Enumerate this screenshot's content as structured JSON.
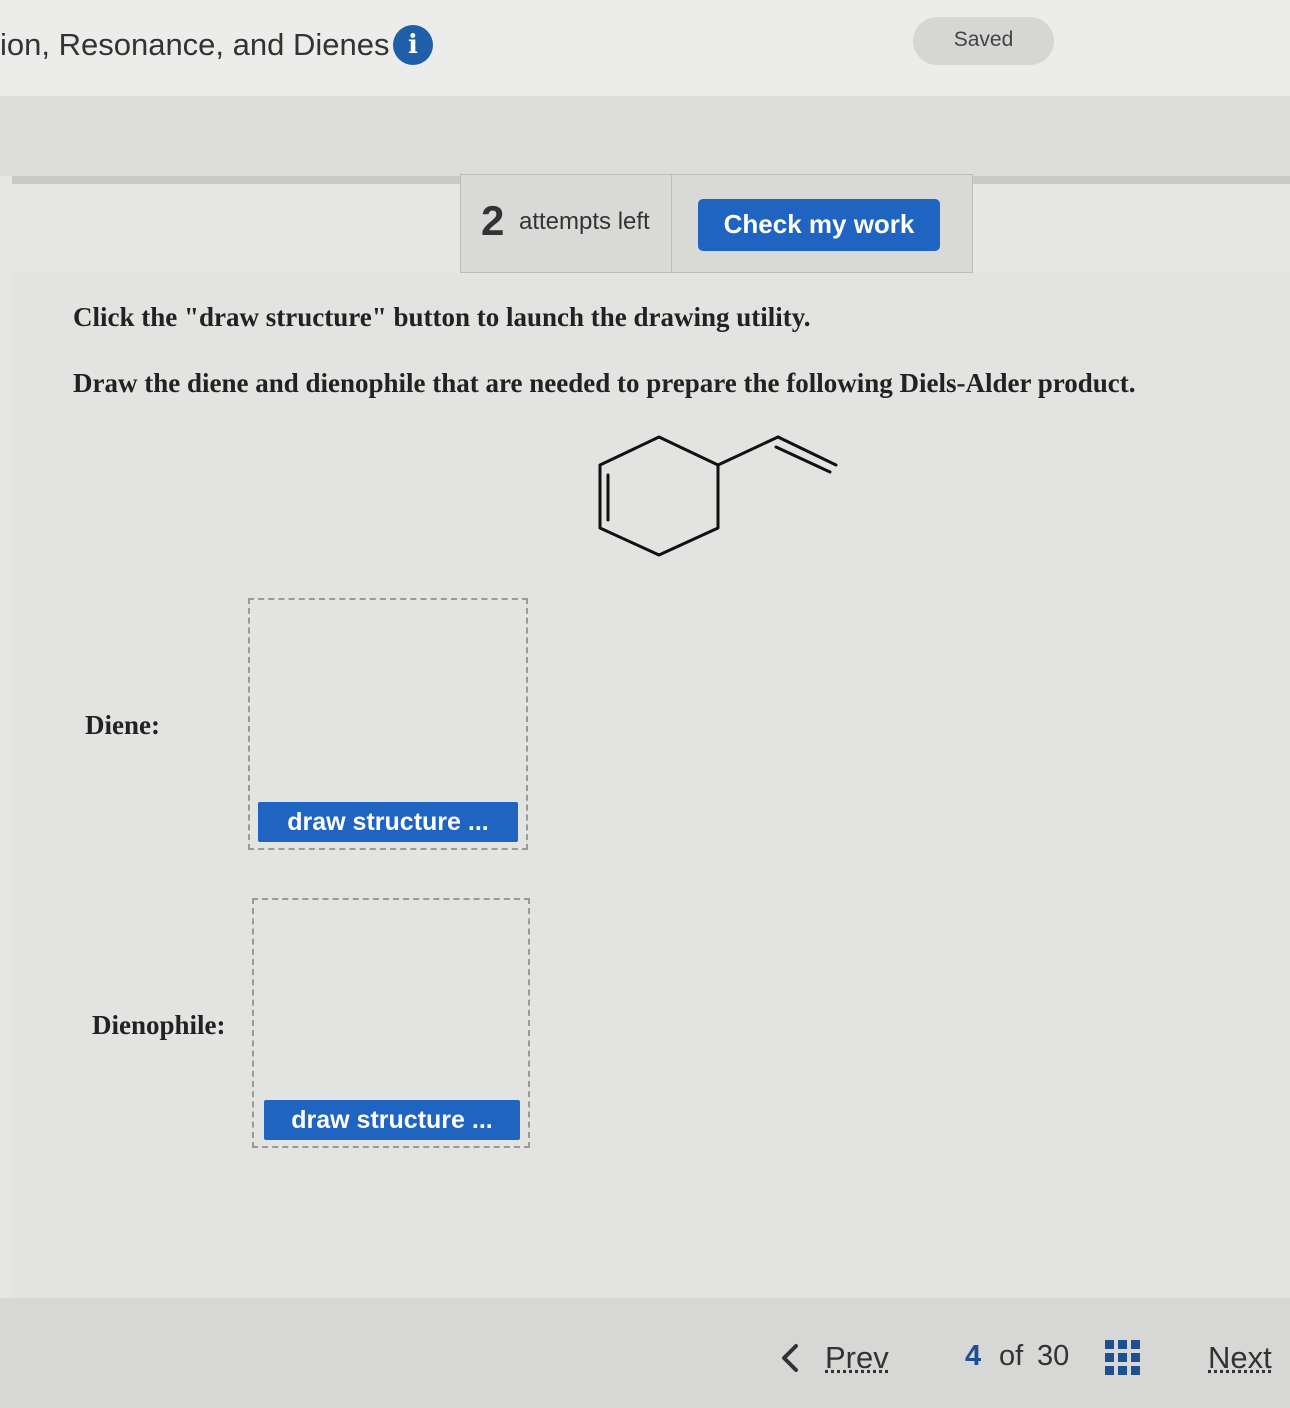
{
  "header": {
    "title": "ion, Resonance, and Dienes",
    "info_icon": "i",
    "saved_label": "Saved"
  },
  "attempts": {
    "count": "2",
    "label": "attempts left",
    "check_button": "Check my work"
  },
  "instructions": {
    "line1": "Click the \"draw structure\" button to launch the drawing utility.",
    "line2": "Draw the diene and dienophile that are needed to prepare the following Diels-Alder product."
  },
  "questions": [
    {
      "label": "Diene:",
      "button": "draw structure ..."
    },
    {
      "label": "Dienophile:",
      "button": "draw structure ..."
    }
  ],
  "footer": {
    "prev_icon": "chevron-left-icon",
    "prev": "Prev",
    "page_current": "4",
    "page_of": "of",
    "page_total": "30",
    "grid_icon": "grid-icon",
    "next": "Next"
  },
  "colors": {
    "accent_button": "#1e64c0",
    "info_icon": "#1f5fa8",
    "page_current": "#1e4f90"
  }
}
